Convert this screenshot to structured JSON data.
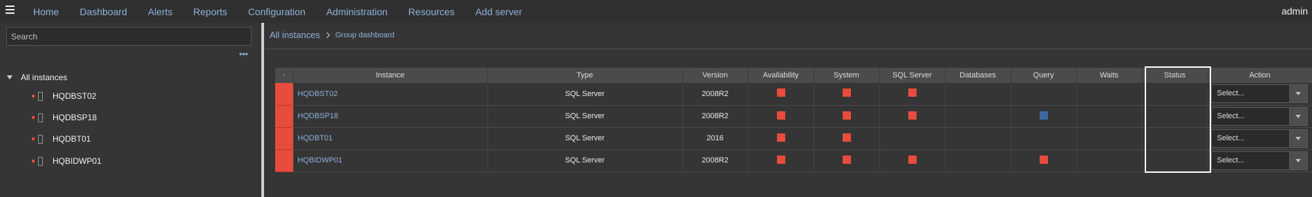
{
  "nav": {
    "items": [
      "Home",
      "Dashboard",
      "Alerts",
      "Reports",
      "Configuration",
      "Administration",
      "Resources",
      "Add server"
    ],
    "user": "admin"
  },
  "sidebar": {
    "search_placeholder": "Search",
    "more_label": "•••",
    "root_label": "All instances",
    "items": [
      {
        "label": "HQDBST02"
      },
      {
        "label": "HQDBSP18"
      },
      {
        "label": "HQDBT01"
      },
      {
        "label": "HQBIDWP01"
      }
    ]
  },
  "breadcrumb": {
    "root": "All instances",
    "current": "Group dashboard"
  },
  "table": {
    "sort_icon": "↑",
    "columns": [
      "Instance",
      "Type",
      "Version",
      "Availability",
      "System",
      "SQL Server",
      "Databases",
      "Query",
      "Waits",
      "Status",
      "Action"
    ],
    "rows": [
      {
        "instance": "HQDBST02",
        "type": "SQL Server",
        "version": "2008R2",
        "availability": "red",
        "system": "red",
        "sqlserver": "red",
        "databases": "",
        "query": "",
        "waits": "",
        "status": "",
        "action": "Select..."
      },
      {
        "instance": "HQDBSP18",
        "type": "SQL Server",
        "version": "2008R2",
        "availability": "red",
        "system": "red",
        "sqlserver": "red",
        "databases": "",
        "query": "blue",
        "waits": "",
        "status": "",
        "action": "Select..."
      },
      {
        "instance": "HQDBT01",
        "type": "SQL Server",
        "version": "2016",
        "availability": "red",
        "system": "red",
        "sqlserver": "",
        "databases": "",
        "query": "",
        "waits": "",
        "status": "",
        "action": "Select..."
      },
      {
        "instance": "HQBIDWP01",
        "type": "SQL Server",
        "version": "2008R2",
        "availability": "red",
        "system": "red",
        "sqlserver": "red",
        "databases": "",
        "query": "red",
        "waits": "",
        "status": "",
        "action": "Select..."
      }
    ]
  },
  "colors": {
    "alert_red": "#e74c3c",
    "info_blue": "#3d6a9e",
    "link_blue": "#8fb1d9",
    "background": "#353535"
  }
}
